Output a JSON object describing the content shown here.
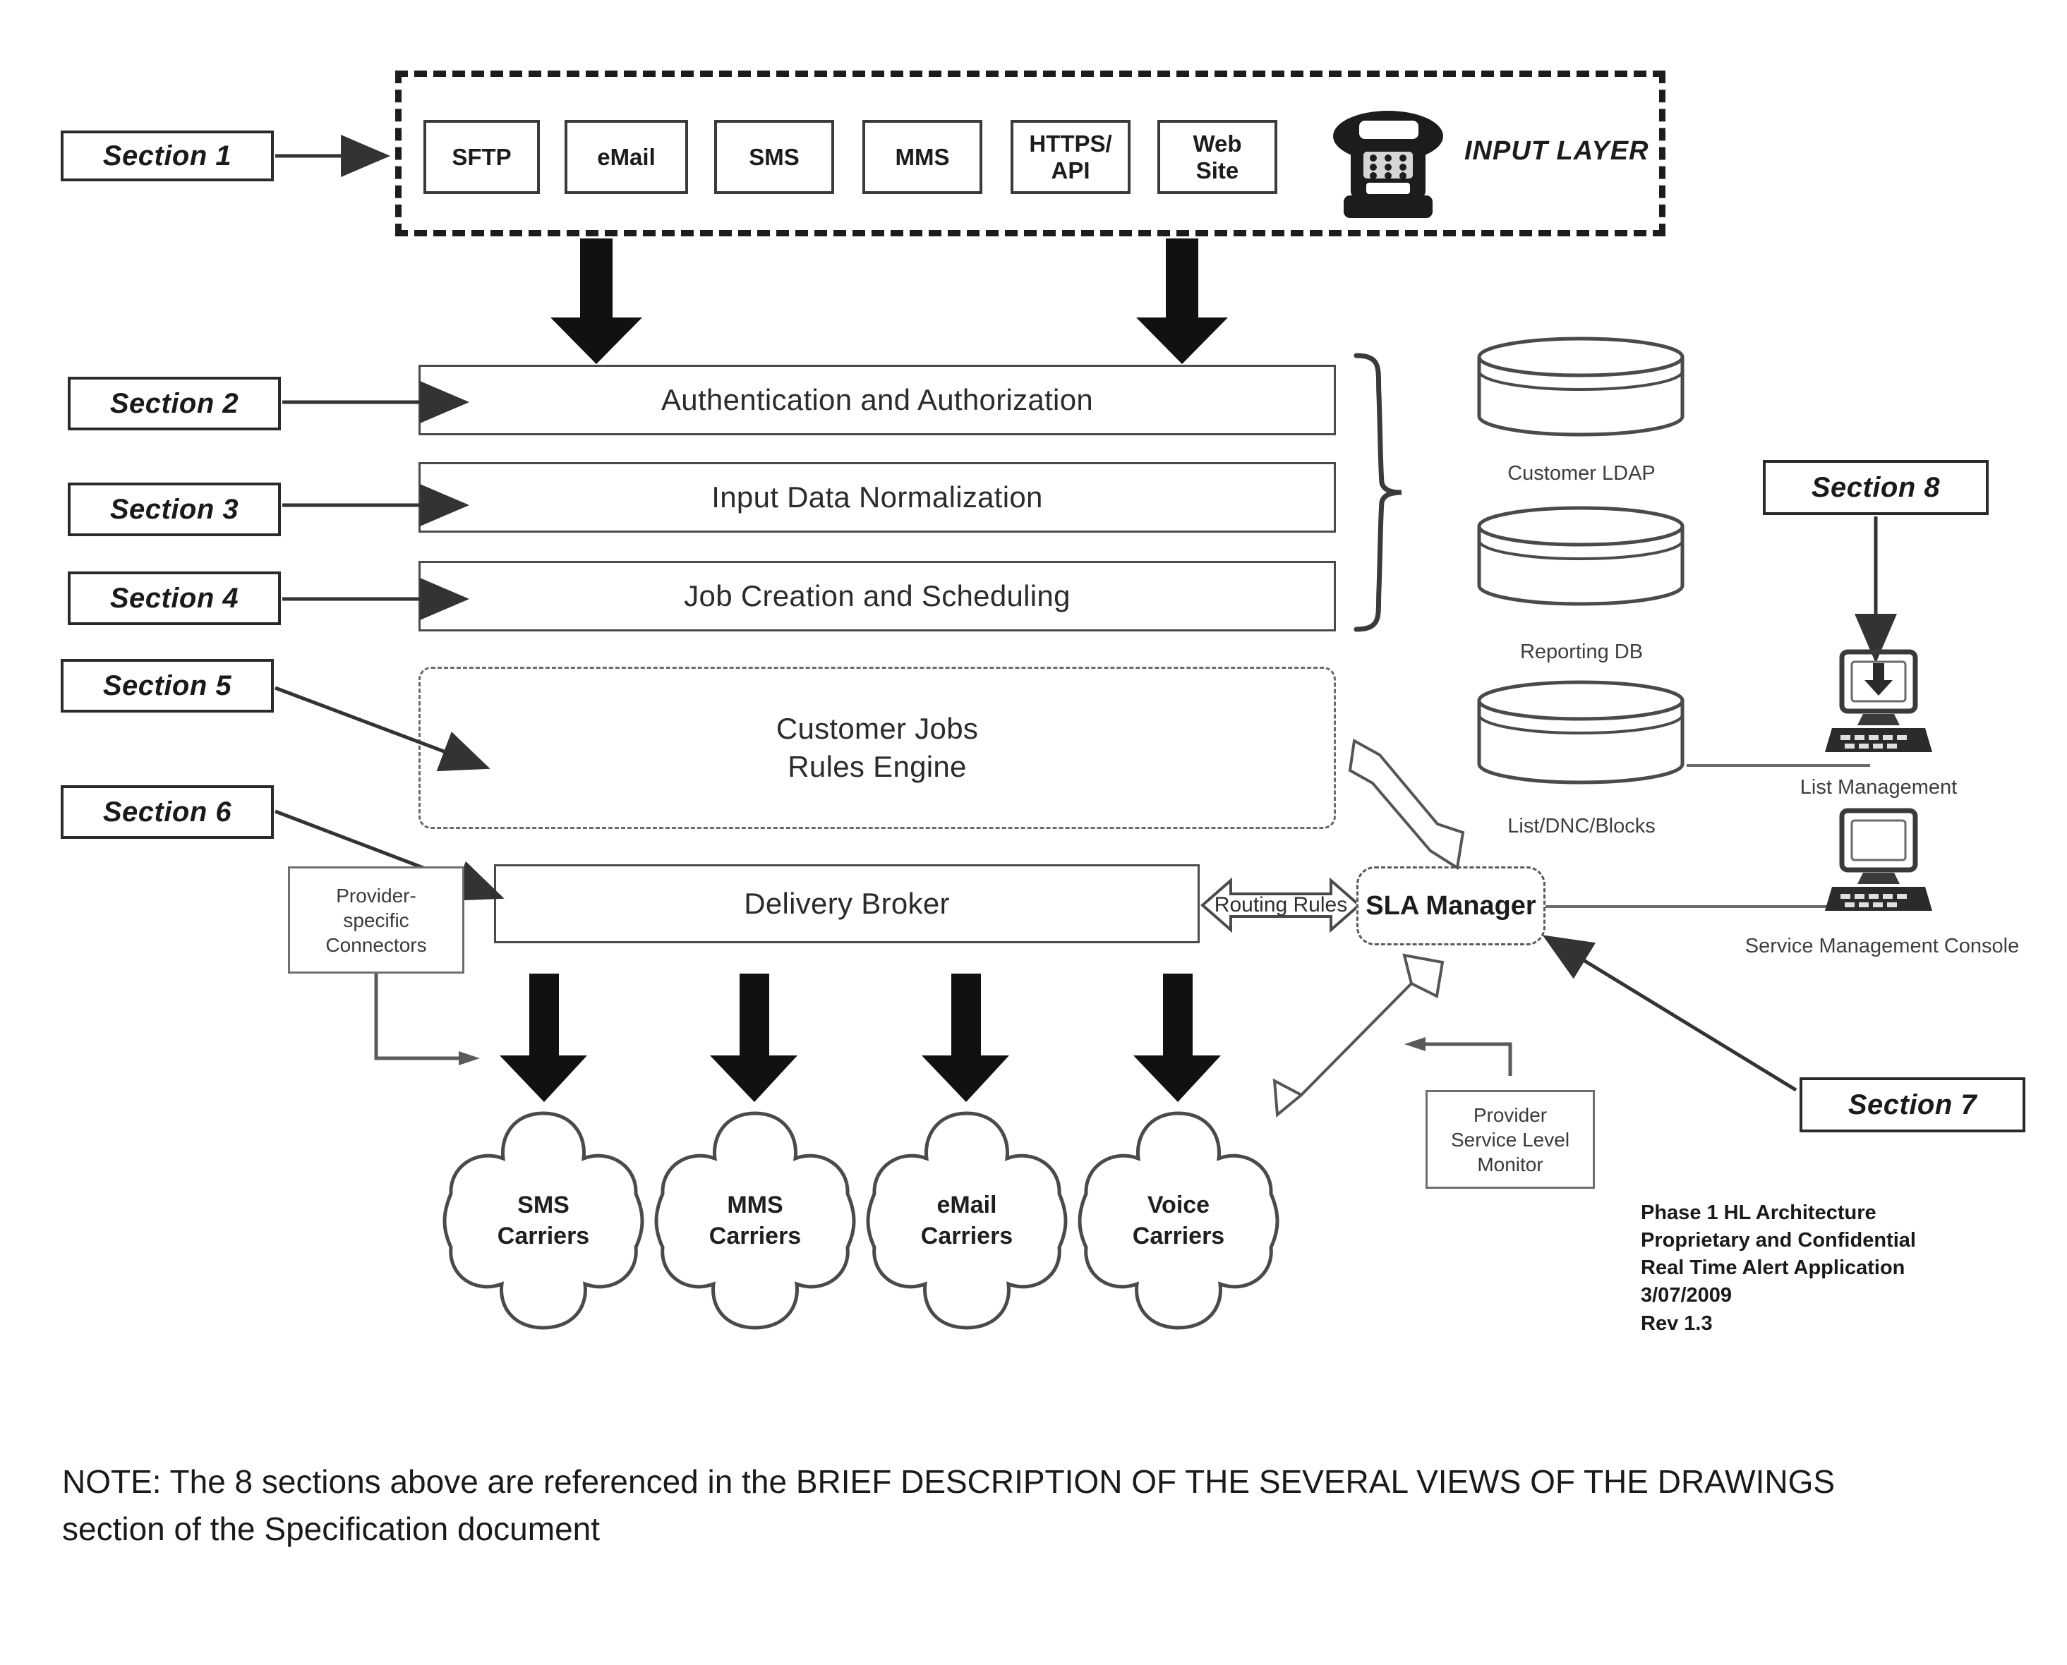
{
  "sections": {
    "s1": "Section 1",
    "s2": "Section 2",
    "s3": "Section 3",
    "s4": "Section 4",
    "s5": "Section 5",
    "s6": "Section 6",
    "s7": "Section 7",
    "s8": "Section 8"
  },
  "input_layer": {
    "label": "INPUT LAYER",
    "channels": [
      {
        "label": "SFTP"
      },
      {
        "label": "eMail"
      },
      {
        "label": "SMS"
      },
      {
        "label": "MMS"
      },
      {
        "label": "HTTPS/\nAPI"
      },
      {
        "label": "Web\nSite"
      }
    ],
    "phone_icon": "telephone-icon"
  },
  "pipeline": {
    "auth": "Authentication and Authorization",
    "normalize": "Input Data Normalization",
    "jobs": "Job Creation and Scheduling",
    "rules_engine_line1": "Customer Jobs",
    "rules_engine_line2": "Rules Engine",
    "delivery_broker": "Delivery Broker"
  },
  "connectors_box": "Provider-\nspecific\nConnectors",
  "routing_rules": "Routing Rules",
  "sla_manager": "SLA Manager",
  "provider_monitor": "Provider\nService Level\nMonitor",
  "databases": [
    {
      "label": "Customer LDAP"
    },
    {
      "label": "Reporting DB"
    },
    {
      "label": "List/DNC/Blocks"
    }
  ],
  "workstations": [
    {
      "label": "List Management"
    },
    {
      "label": "Service Management Console"
    }
  ],
  "carriers": [
    {
      "line1": "SMS",
      "line2": "Carriers"
    },
    {
      "line1": "MMS",
      "line2": "Carriers"
    },
    {
      "line1": "eMail",
      "line2": "Carriers"
    },
    {
      "line1": "Voice",
      "line2": "Carriers"
    }
  ],
  "revision": "Phase 1 HL Architecture\nProprietary and Confidential\nReal Time Alert Application\n3/07/2009\nRev 1.3",
  "note": {
    "line1": "NOTE: The 8 sections above are referenced in the BRIEF DESCRIPTION OF THE SEVERAL VIEWS OF THE DRAWINGS",
    "line2": "section of the Specification document"
  },
  "colors": {
    "ink": "#1a1a1a",
    "box_stroke": "#4a4a4a",
    "dashed_stroke": "#6a6a6a",
    "arrow_black": "#111111"
  }
}
